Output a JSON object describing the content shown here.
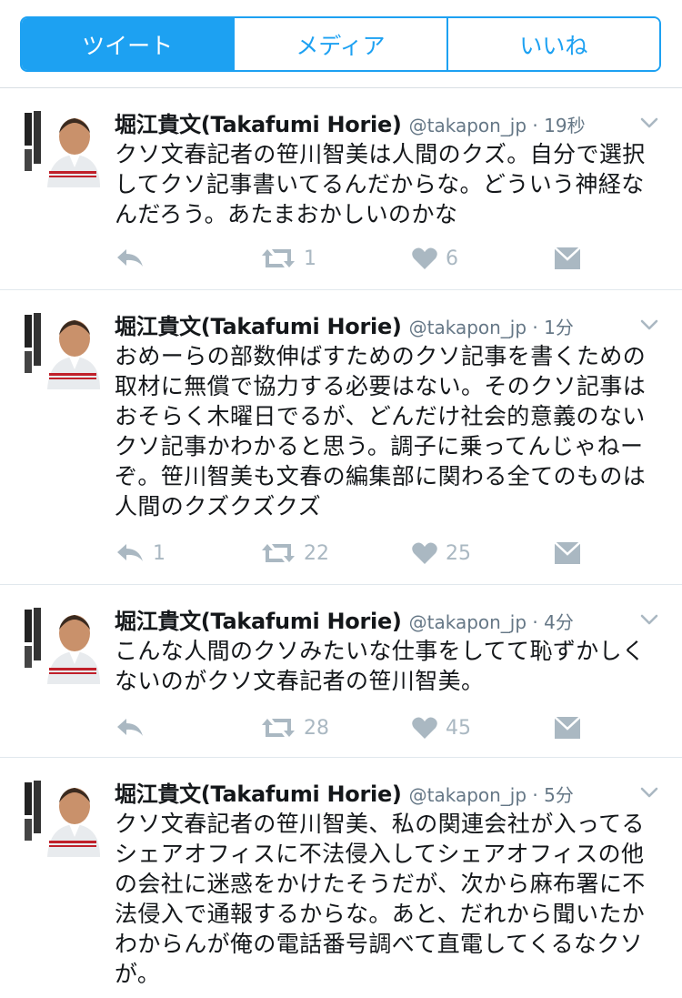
{
  "tabs": [
    {
      "label": "ツイート",
      "active": true
    },
    {
      "label": "メディア",
      "active": false
    },
    {
      "label": "いいね",
      "active": false
    }
  ],
  "colors": {
    "accent": "#1da1f2",
    "muted": "#aab8c2",
    "text": "#14171a",
    "meta": "#657786"
  },
  "tweets": [
    {
      "name": "堀江貴文(Takafumi Horie)",
      "handle": "@takapon_jp",
      "time": "19秒",
      "meta": "@takapon_jp · 19秒",
      "text": "クソ文春記者の笹川智美は人間のクズ。自分で選択してクソ記事書いてるんだからな。どういう神経なんだろう。あたまおかしいのかな",
      "replies": "",
      "retweets": "1",
      "likes": "6"
    },
    {
      "name": "堀江貴文(Takafumi Horie)",
      "handle": "@takapon_jp",
      "time": "1分",
      "meta": "@takapon_jp · 1分",
      "text": "おめーらの部数伸ばすためのクソ記事を書くための取材に無償で協力する必要はない。そのクソ記事はおそらく木曜日でるが、どんだけ社会的意義のないクソ記事かわかると思う。調子に乗ってんじゃねーぞ。笹川智美も文春の編集部に関わる全てのものは人間のクズクズクズ",
      "replies": "1",
      "retweets": "22",
      "likes": "25"
    },
    {
      "name": "堀江貴文(Takafumi Horie)",
      "handle": "@takapon_jp",
      "time": "4分",
      "meta": "@takapon_jp · 4分",
      "text": "こんな人間のクソみたいな仕事をしてて恥ずかしくないのがクソ文春記者の笹川智美。",
      "replies": "",
      "retweets": "28",
      "likes": "45"
    },
    {
      "name": "堀江貴文(Takafumi Horie)",
      "handle": "@takapon_jp",
      "time": "5分",
      "meta": "@takapon_jp · 5分",
      "text": "クソ文春記者の笹川智美、私の関連会社が入ってるシェアオフィスに不法侵入してシェアオフィスの他の会社に迷惑をかけたそうだが、次から麻布署に不法侵入で通報するからな。あと、だれから聞いたかわからんが俺の電話番号調べて直電してくるなクソが。",
      "replies": "",
      "retweets": "",
      "likes": ""
    }
  ]
}
